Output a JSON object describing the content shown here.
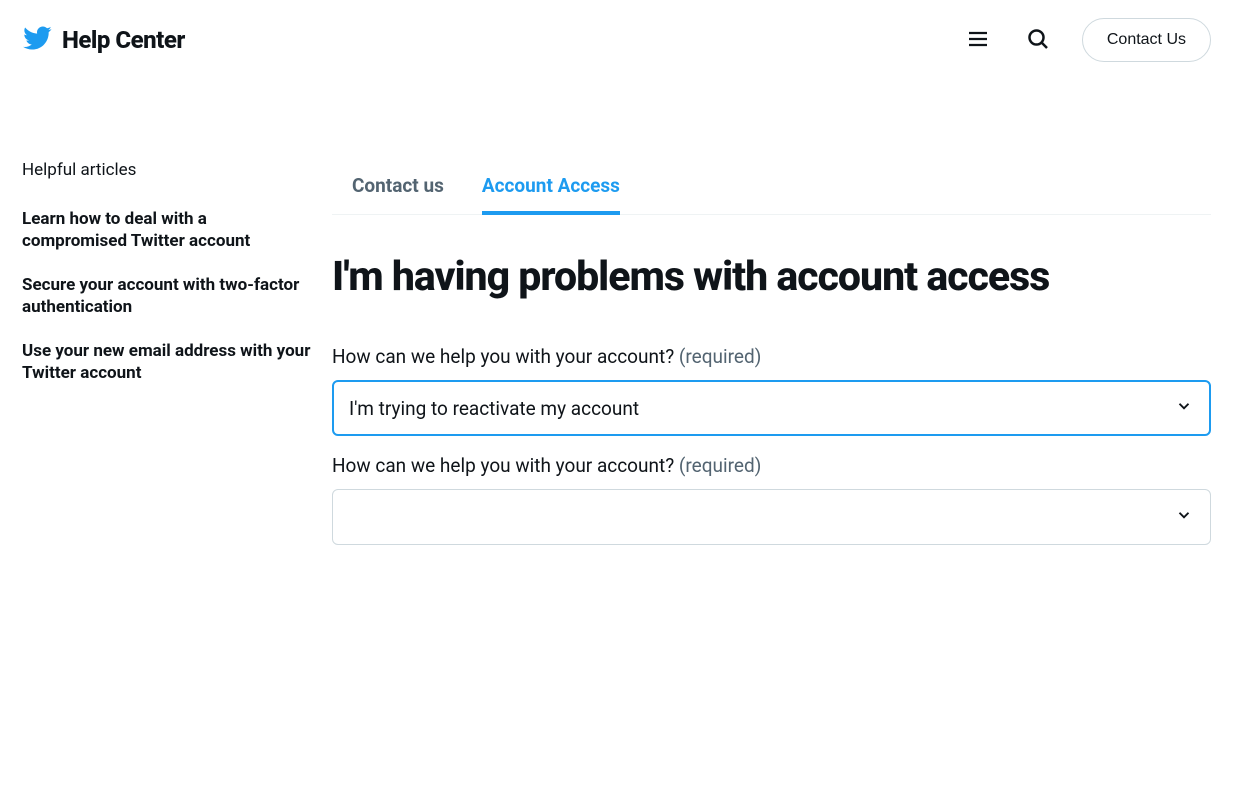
{
  "header": {
    "site_title": "Help Center",
    "contact_us_label": "Contact Us"
  },
  "sidebar": {
    "heading": "Helpful articles",
    "links": [
      "Learn how to deal with a compromised Twitter account",
      "Secure your account with two-factor authentication",
      "Use your new email address with your Twitter account"
    ]
  },
  "breadcrumb": {
    "items": [
      {
        "label": "Contact us",
        "active": false
      },
      {
        "label": "Account Access",
        "active": true
      }
    ]
  },
  "main": {
    "title": "I'm having problems with account access",
    "fields": [
      {
        "label": "How can we help you with your account?",
        "required_text": "(required)",
        "value": "I'm trying to reactivate my account",
        "focused": true
      },
      {
        "label": "How can we help you with your account?",
        "required_text": "(required)",
        "value": "",
        "focused": false
      }
    ]
  }
}
